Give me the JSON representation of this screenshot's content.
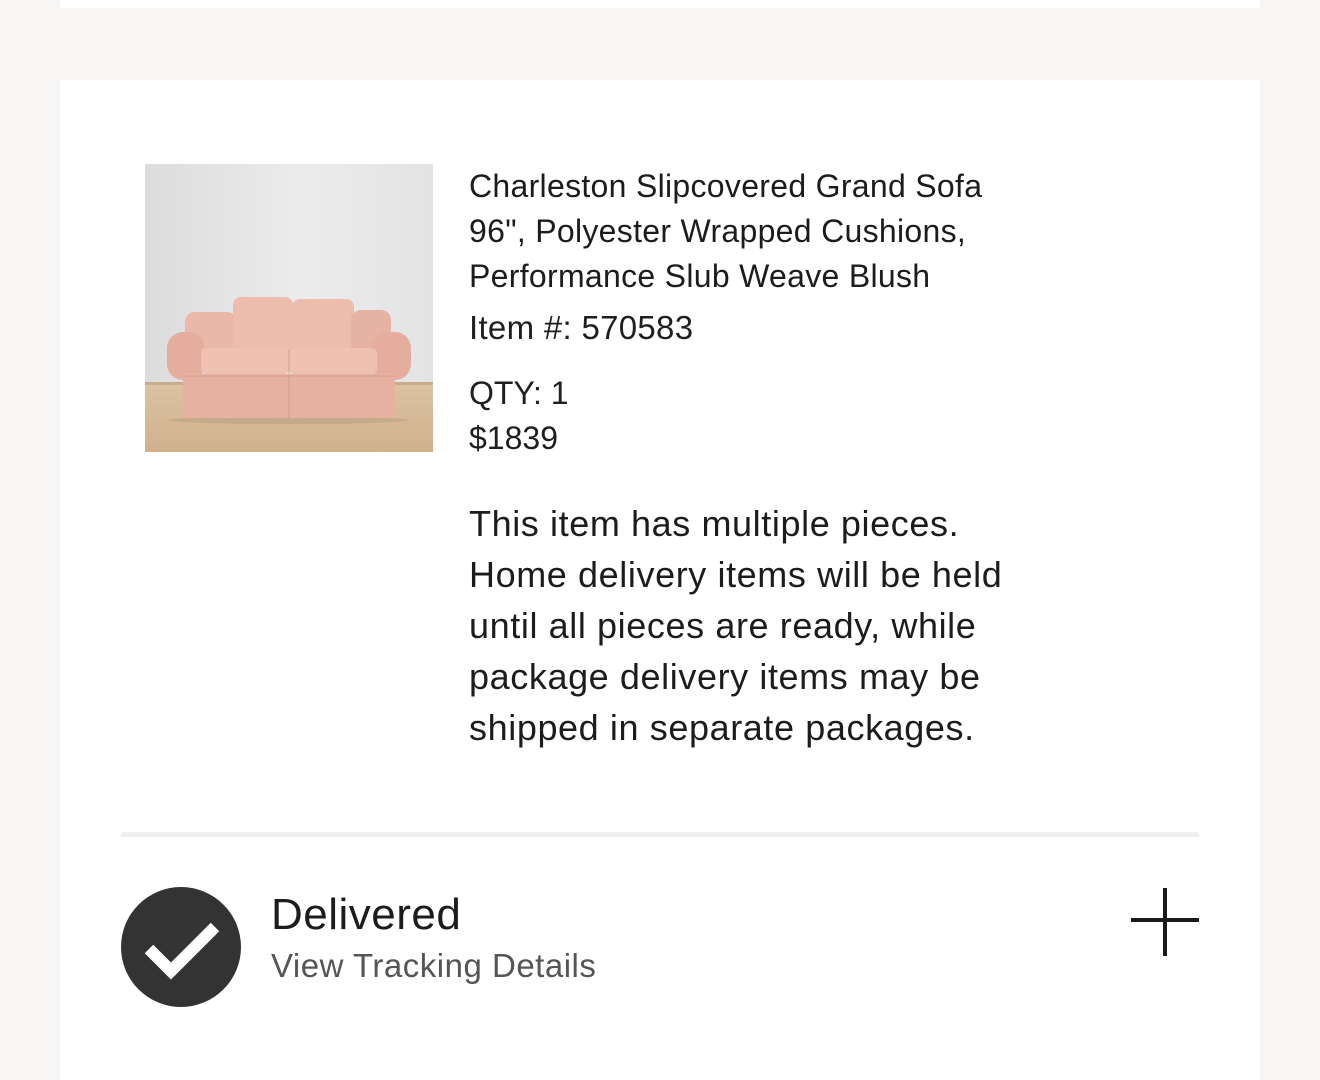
{
  "product": {
    "title_lines": [
      "Charleston Slipcovered Grand Sofa",
      "96\", Polyester Wrapped Cushions,",
      "Performance Slub Weave Blush"
    ],
    "item_number": "Item #: 570583",
    "qty": "QTY: 1",
    "price": "$1839",
    "image_alt": "sofa-photo"
  },
  "notice": {
    "lines": [
      "This item has multiple pieces.",
      "Home delivery items will be held",
      "until all pieces are ready, while",
      "package delivery items may be",
      "shipped in separate packages."
    ]
  },
  "status": {
    "label": "Delivered",
    "link": "View Tracking Details",
    "icon": "checkmark-icon",
    "expand_icon": "plus-icon"
  },
  "colors": {
    "page_bg": "#f7f6f4",
    "card_bg": "#ffffff",
    "status_circle": "#333333",
    "sofa": "#e8b5a6"
  }
}
